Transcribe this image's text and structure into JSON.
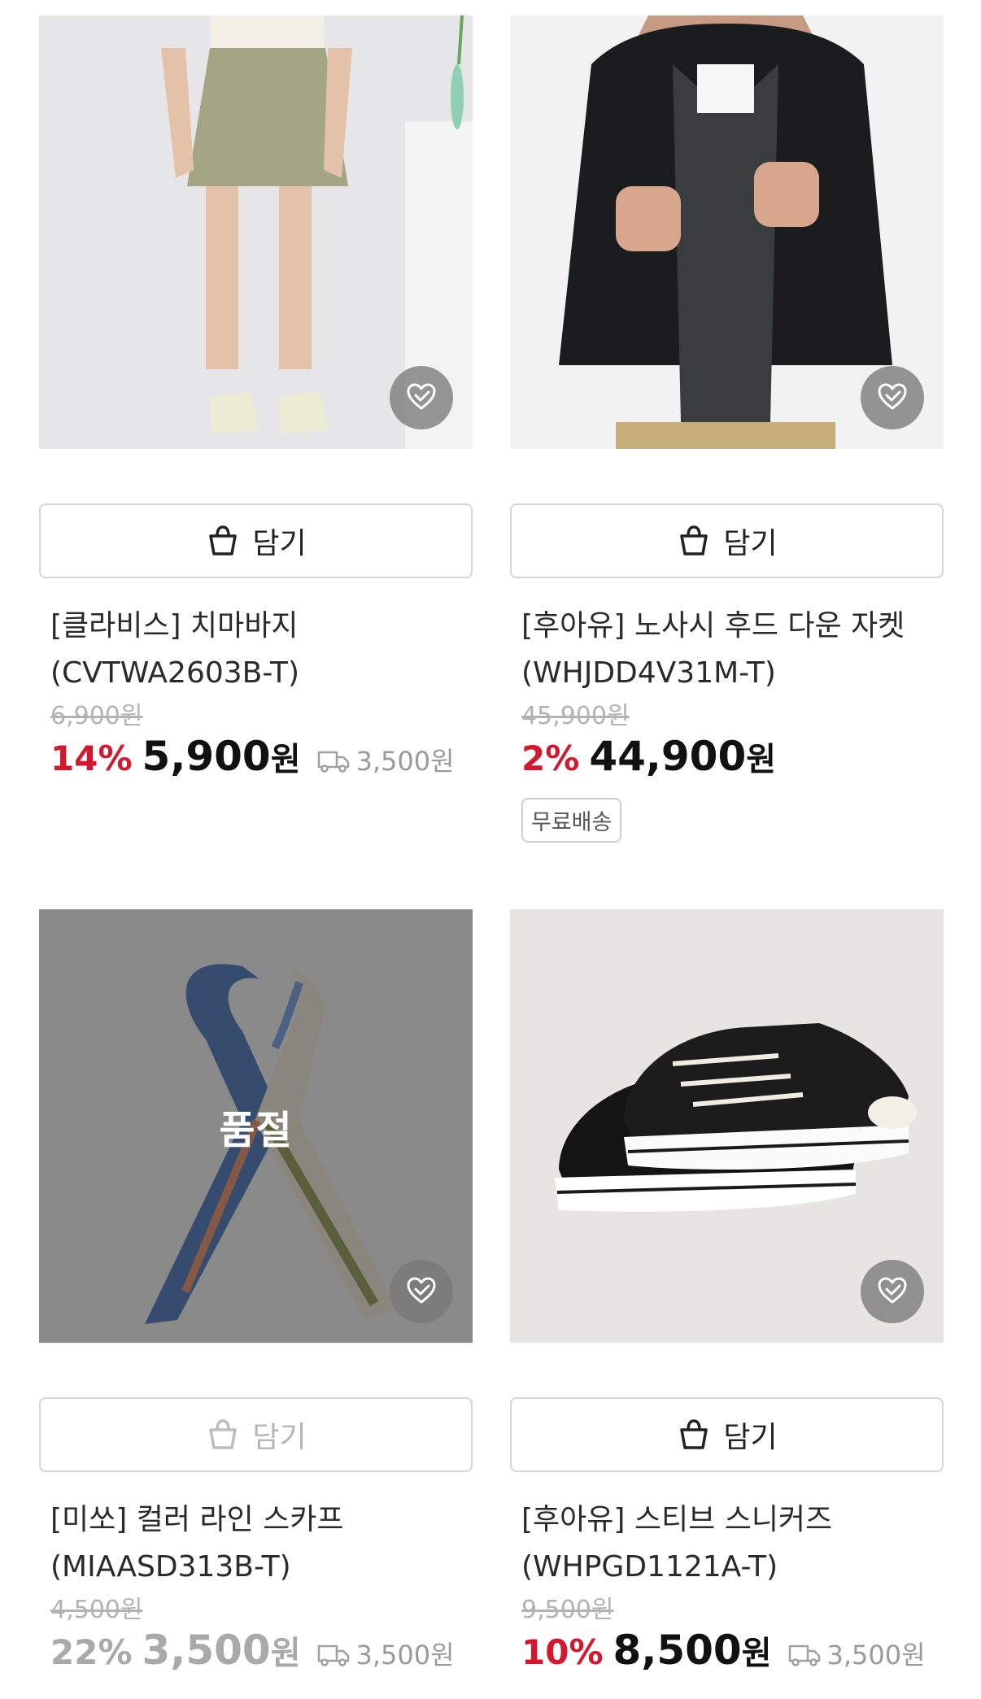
{
  "products": [
    {
      "id": "skirt",
      "brand_name": "[클라비스] 치마바지",
      "code": "(CVTWA2603B-T)",
      "original_price": "6,900원",
      "discount": "14%",
      "price": "5,900",
      "currency": "원",
      "shipping_fee": "3,500원",
      "cart_label": "담기",
      "sold_out": false
    },
    {
      "id": "jacket",
      "brand_name": "[후아유] 노사시 후드 다운 자켓",
      "code": "(WHJDD4V31M-T)",
      "original_price": "45,900원",
      "discount": "2%",
      "price": "44,900",
      "currency": "원",
      "badge": "무료배송",
      "cart_label": "담기",
      "sold_out": false
    },
    {
      "id": "scarf",
      "brand_name": "[미쏘] 컬러 라인 스카프",
      "code": "(MIAASD313B-T)",
      "original_price": "4,500원",
      "discount": "22%",
      "price": "3,500",
      "currency": "원",
      "shipping_fee": "3,500원",
      "cart_label": "담기",
      "sold_out": true,
      "sold_out_label": "품절"
    },
    {
      "id": "sneakers",
      "brand_name": "[후아유] 스티브 스니커즈",
      "code": "(WHPGD1121A-T)",
      "original_price": "9,500원",
      "discount": "10%",
      "price": "8,500",
      "currency": "원",
      "shipping_fee": "3,500원",
      "cart_label": "담기",
      "sold_out": false
    }
  ],
  "icons": {
    "like": "heart-check-icon",
    "cart": "shopping-bag-icon",
    "shipping": "delivery-truck-icon"
  },
  "colors": {
    "discount": "#d2182e",
    "sold_out_overlay": "#3c3c3c",
    "border": "#d6d6d6"
  }
}
